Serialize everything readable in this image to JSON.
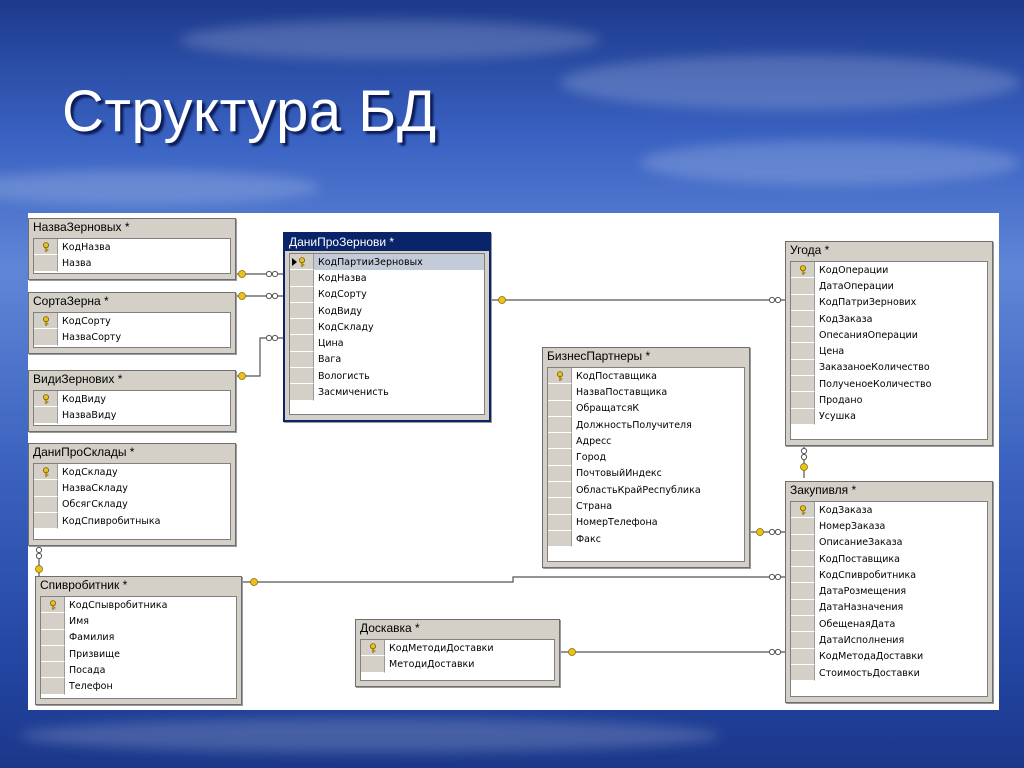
{
  "title": "Структура БД",
  "tables": [
    {
      "id": "t1",
      "title": "НазваЗерновых *",
      "columns": [
        {
          "name": "КодНазва",
          "key": true
        },
        {
          "name": "Назва",
          "key": false
        }
      ]
    },
    {
      "id": "t2",
      "title": "СортаЗерна *",
      "columns": [
        {
          "name": "КодСорту",
          "key": true
        },
        {
          "name": "НазваСорту",
          "key": false
        }
      ]
    },
    {
      "id": "t3",
      "title": "ВидиЗернових *",
      "columns": [
        {
          "name": "КодВиду",
          "key": true
        },
        {
          "name": "НазваВиду",
          "key": false
        }
      ]
    },
    {
      "id": "t4",
      "title": "ДаниПроСклады *",
      "columns": [
        {
          "name": "КодСкладу",
          "key": true
        },
        {
          "name": "НазваСкладу",
          "key": false
        },
        {
          "name": "ОбсягСкладу",
          "key": false
        },
        {
          "name": "КодСпивробитныка",
          "key": false
        }
      ]
    },
    {
      "id": "t5",
      "title": "ДаниПроЗернови *",
      "selected": true,
      "columns": [
        {
          "name": "КодПартииЗерновых",
          "key": true,
          "current": true
        },
        {
          "name": "КодНазва",
          "key": false
        },
        {
          "name": "КодСорту",
          "key": false
        },
        {
          "name": "КодВиду",
          "key": false
        },
        {
          "name": "КодСкладу",
          "key": false
        },
        {
          "name": "Цина",
          "key": false
        },
        {
          "name": "Вага",
          "key": false
        },
        {
          "name": "Вологисть",
          "key": false
        },
        {
          "name": "Засмиченисть",
          "key": false
        }
      ]
    },
    {
      "id": "t6",
      "title": "Угода *",
      "columns": [
        {
          "name": "КодОперации",
          "key": true
        },
        {
          "name": "ДатаОперации",
          "key": false
        },
        {
          "name": "КодПатриЗернових",
          "key": false
        },
        {
          "name": "КодЗаказа",
          "key": false
        },
        {
          "name": "ОпесанияОперации",
          "key": false
        },
        {
          "name": "Цена",
          "key": false
        },
        {
          "name": "ЗаказаноеКоличество",
          "key": false
        },
        {
          "name": "ПолученоеКоличество",
          "key": false
        },
        {
          "name": "Продано",
          "key": false
        },
        {
          "name": "Усушка",
          "key": false
        }
      ]
    },
    {
      "id": "t7",
      "title": "БизнесПартнеры *",
      "columns": [
        {
          "name": "КодПоставщика",
          "key": true
        },
        {
          "name": "НазваПоставщика",
          "key": false
        },
        {
          "name": "ОбращатсяК",
          "key": false
        },
        {
          "name": "ДолжностьПолучителя",
          "key": false
        },
        {
          "name": "Адресс",
          "key": false
        },
        {
          "name": "Город",
          "key": false
        },
        {
          "name": "ПочтовыйИндекс",
          "key": false
        },
        {
          "name": "ОбластьКрайРеспублика",
          "key": false
        },
        {
          "name": "Страна",
          "key": false
        },
        {
          "name": "НомерТелефона",
          "key": false
        },
        {
          "name": "Факс",
          "key": false
        }
      ]
    },
    {
      "id": "t8",
      "title": "Закупивля *",
      "columns": [
        {
          "name": "КодЗаказа",
          "key": true
        },
        {
          "name": "НомерЗаказа",
          "key": false
        },
        {
          "name": "ОписаниеЗаказа",
          "key": false
        },
        {
          "name": "КодПоставщика",
          "key": false
        },
        {
          "name": "КодСпивробитника",
          "key": false
        },
        {
          "name": "ДатаРозмещения",
          "key": false
        },
        {
          "name": "ДатаНазначения",
          "key": false
        },
        {
          "name": "ОбещенаяДата",
          "key": false
        },
        {
          "name": "ДатаИсполнения",
          "key": false
        },
        {
          "name": "КодМетодаДоставки",
          "key": false
        },
        {
          "name": "СтоимостьДоставки",
          "key": false
        }
      ]
    },
    {
      "id": "t9",
      "title": "Спивробитник *",
      "columns": [
        {
          "name": "КодСпывробитника",
          "key": true
        },
        {
          "name": "Имя",
          "key": false
        },
        {
          "name": "Фамилия",
          "key": false
        },
        {
          "name": "Призвище",
          "key": false
        },
        {
          "name": "Посада",
          "key": false
        },
        {
          "name": "Телефон",
          "key": false
        }
      ]
    },
    {
      "id": "t10",
      "title": "Доскавка *",
      "columns": [
        {
          "name": "КодМетодиДоставки",
          "key": true
        },
        {
          "name": "МетодиДоставки",
          "key": false
        }
      ]
    }
  ],
  "colors": {
    "key": "#e8c21e",
    "line": "#555555",
    "header_selected": "#0a246a"
  }
}
